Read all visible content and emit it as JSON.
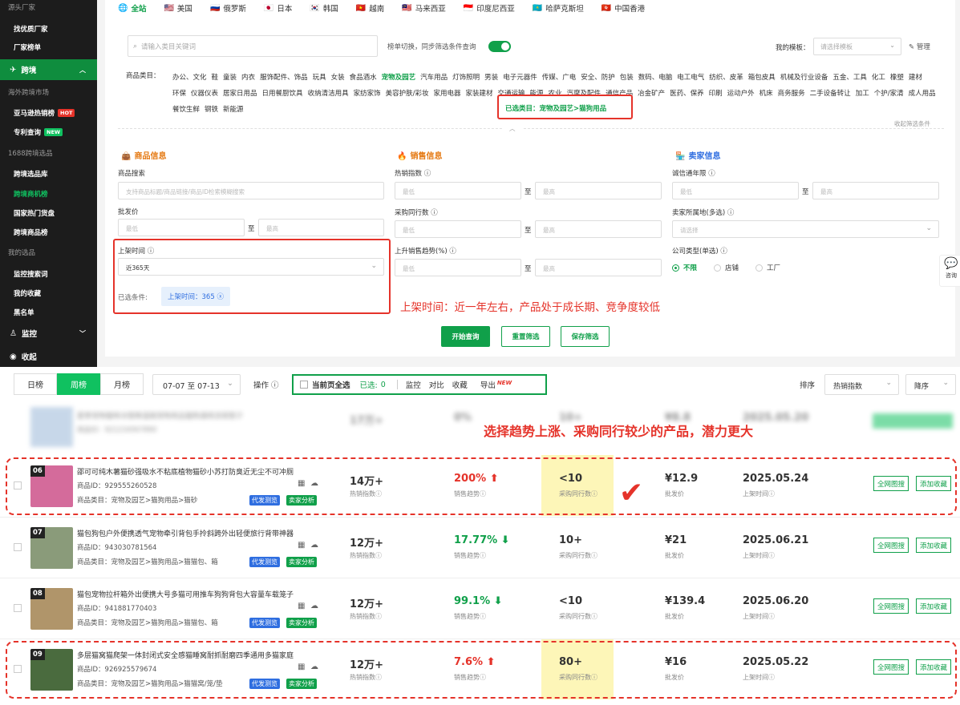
{
  "sidebar": {
    "source_label": "源头厂家",
    "items_top": [
      "找优质厂家",
      "厂家榜单"
    ],
    "cross_border": "跨境",
    "overseas_label": "海外跨境市场",
    "amazon": "亚马逊热销榜",
    "amazon_badge": "HOT",
    "patent": "专利查询",
    "patent_badge": "NEW",
    "sel1688": "1688跨境选品",
    "items_mid": [
      "跨境选品库",
      "跨境商机榜",
      "国家热门货盘",
      "跨境商品榜"
    ],
    "my_sel": "我的选品",
    "items_bot": [
      "监控搜索词",
      "我的收藏",
      "黑名单"
    ],
    "monitor": "监控",
    "collapse": "收起"
  },
  "countries": [
    {
      "flag": "🌐",
      "name": "全站"
    },
    {
      "flag": "🇺🇸",
      "name": "美国"
    },
    {
      "flag": "🇷🇺",
      "name": "俄罗斯"
    },
    {
      "flag": "🇯🇵",
      "name": "日本"
    },
    {
      "flag": "🇰🇷",
      "name": "韩国"
    },
    {
      "flag": "🇻🇳",
      "name": "越南"
    },
    {
      "flag": "🇲🇾",
      "name": "马来西亚"
    },
    {
      "flag": "🇮🇩",
      "name": "印度尼西亚"
    },
    {
      "flag": "🇰🇿",
      "name": "哈萨克斯坦"
    },
    {
      "flag": "🇭🇰",
      "name": "中国香港"
    }
  ],
  "search": {
    "placeholder": "请输入类目关键词",
    "toggle_label": "榜单切换，同步筛选条件查询",
    "template_label": "我的模板：",
    "template_placeholder": "请选择模板",
    "manage": "管理"
  },
  "category": {
    "label": "商品类目：",
    "items": [
      "办公、文化",
      "鞋",
      "童装",
      "内衣",
      "服饰配件、饰品",
      "玩具",
      "女装",
      "食品酒水",
      "宠物及园艺",
      "汽车用品",
      "灯饰照明",
      "男装",
      "电子元器件",
      "传媒、广电",
      "安全、防护",
      "包装",
      "数码、电脑",
      "电工电气",
      "纺织、皮革",
      "箱包皮具",
      "机械及行业设备",
      "五金、工具",
      "化工",
      "橡塑",
      "建材",
      "环保",
      "仪器仪表",
      "居家日用品",
      "日用餐厨饮具",
      "收纳清洁用具",
      "家纺家饰",
      "美容护肤/彩妆",
      "家用电器",
      "家装建材",
      "交通运输",
      "能源",
      "农业",
      "汽摩及配件",
      "通信产品",
      "冶金矿产",
      "医药、保养",
      "印刷",
      "运动户外",
      "机床",
      "商务服务",
      "二手设备转让",
      "加工",
      "个护/家清",
      "成人用品",
      "餐饮生鲜",
      "钢铁",
      "新能源"
    ],
    "highlight": "宠物及园艺",
    "selected": "已选类目：宠物及园艺>猫狗用品",
    "collapse": "收起筛选条件"
  },
  "filters": {
    "product_title": "商品信息",
    "sales_title": "销售信息",
    "seller_title": "卖家信息",
    "product_search": "商品搜索",
    "product_search_ph": "支持商品标题/商品链接/商品ID检索模糊搜索",
    "wholesale": "批发价",
    "min": "最低",
    "max": "最高",
    "to": "至",
    "listing_time": "上架时间",
    "listing_value": "近365天",
    "selected_cond": "已选条件:",
    "selected_tag": "上架时间：365",
    "hot_index": "热销指数",
    "peers": "采购同行数",
    "trend": "上升销售趋势(%)",
    "integrity": "诚信通年限",
    "location": "卖家所属地(多选)",
    "location_ph": "请选择",
    "company_type": "公司类型(单选)",
    "company_opts": [
      "不限",
      "店铺",
      "工厂"
    ],
    "annotation": "上架时间：近一年左右，产品处于成长期、竞争度较低"
  },
  "buttons": {
    "query": "开始查询",
    "reset": "重置筛选",
    "save": "保存筛选"
  },
  "consult": "咨询",
  "toolbar": {
    "tabs": [
      "日榜",
      "周榜",
      "月榜"
    ],
    "date_range": "07-07 至 07-13",
    "op_label": "操作",
    "select_all": "当前页全选",
    "selected": "已选:",
    "selected_count": "0",
    "actions": [
      "监控",
      "对比",
      "收藏",
      "导出"
    ],
    "new_badge": "NEW",
    "sort_label": "排序",
    "sort_field": "热销指数",
    "sort_order": "降序"
  },
  "annotation2": "选择趋势上涨、采购同行较少的产品，潜力更大",
  "blurred_row": {
    "title": "夏季宠物猫咪冰垫降温窝宠物用品猫狗通用凉席垫子",
    "id": "商品ID：921234567890",
    "hot": "17万+",
    "trend": "0%",
    "peers": "10+",
    "price": "¥8.8",
    "date": "2025.05.20"
  },
  "labels": {
    "id_prefix": "商品ID：",
    "cat_prefix": "商品类目：",
    "hot": "热销指数",
    "trend": "销售趋势",
    "peers": "采购同行数",
    "price": "批发价",
    "listing": "上架时间",
    "tag_dropship": "代发测览",
    "tag_seller": "卖家分析",
    "btn_search": "全网图搜",
    "btn_fav": "添加收藏"
  },
  "rows": [
    {
      "rank": "06",
      "title": "邵可可纯木薯猫砂强吸水不粘底植物猫砂小苏打防臭近无尘不可冲厕",
      "id": "929555260528",
      "cat": "宠物及园艺>猫狗用品>猫砂",
      "hot": "14万+",
      "trend": "200%",
      "dir": "up",
      "peers": "<10",
      "price": "¥12.9",
      "date": "2025.05.24",
      "highlight": true
    },
    {
      "rank": "07",
      "title": "猫包狗包户外便携透气宠物牵引背包手拎斜跨外出轻便旅行背带神器",
      "id": "943030781564",
      "cat": "宠物及园艺>猫狗用品>猫猫包、箱",
      "hot": "12万+",
      "trend": "17.77%",
      "dir": "down",
      "peers": "10+",
      "price": "¥21",
      "date": "2025.06.21",
      "highlight": false
    },
    {
      "rank": "08",
      "title": "猫包宠物拉杆箱外出便携大号多猫可用推车狗狗背包大容量车载笼子",
      "id": "941881770403",
      "cat": "宠物及园艺>猫狗用品>猫猫包、箱",
      "hot": "12万+",
      "trend": "99.1%",
      "dir": "down",
      "peers": "<10",
      "price": "¥139.4",
      "date": "2025.06.20",
      "highlight": false
    },
    {
      "rank": "09",
      "title": "多层猫窝猫爬架一体封闭式安全感猫睡窝耐抓耐磨四季通用多猫家庭",
      "id": "926925579674",
      "cat": "宠物及园艺>猫狗用品>猫猫窝/笼/垫",
      "hot": "12万+",
      "trend": "7.6%",
      "dir": "up",
      "peers": "80+",
      "price": "¥16",
      "date": "2025.05.22",
      "highlight": true
    }
  ],
  "colors": {
    "green": "#10a04a",
    "red": "#e5332a",
    "highlight": "#fdf6b8"
  }
}
